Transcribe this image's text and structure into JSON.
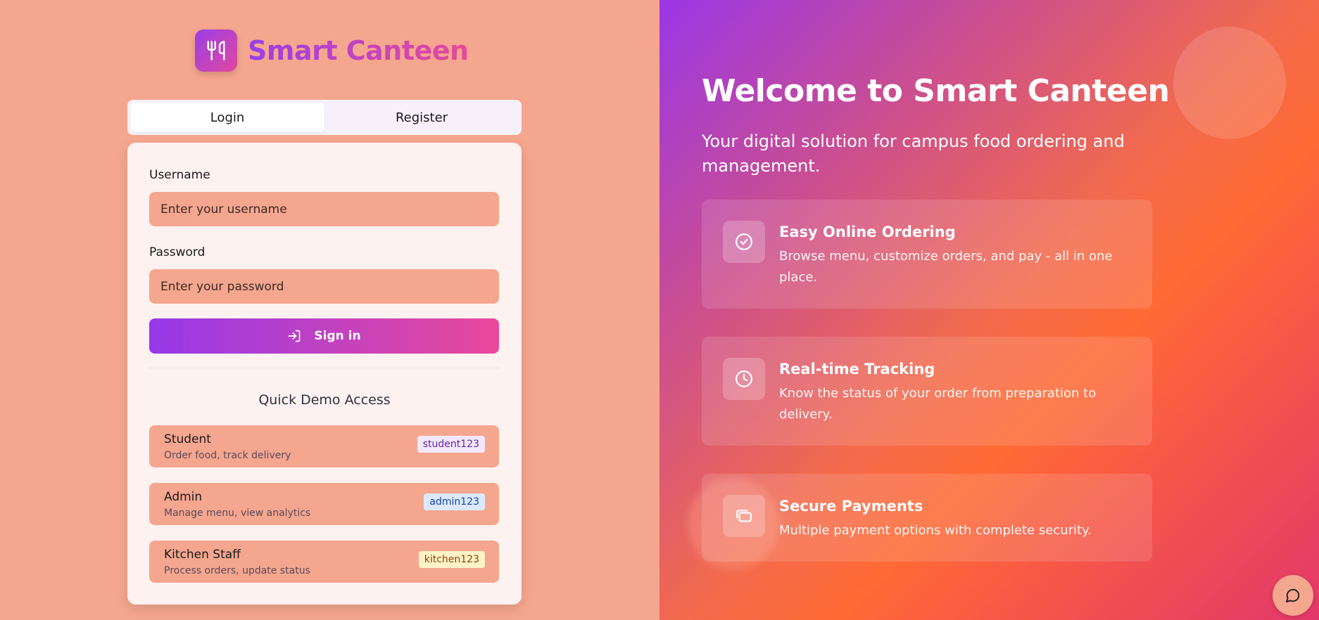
{
  "brand": {
    "name": "Smart Canteen"
  },
  "tabs": [
    {
      "label": "Login",
      "active": true
    },
    {
      "label": "Register",
      "active": false
    }
  ],
  "form": {
    "username_label": "Username",
    "username_placeholder": "Enter your username",
    "password_label": "Password",
    "password_placeholder": "Enter your password",
    "signin_label": "Sign in"
  },
  "quick_demo": {
    "title": "Quick Demo Access",
    "accounts": [
      {
        "role": "Student",
        "desc": "Order food, track delivery",
        "password": "student123",
        "badge_bg": "#f3e8ff",
        "badge_color": "#6b21a8"
      },
      {
        "role": "Admin",
        "desc": "Manage menu, view analytics",
        "password": "admin123",
        "badge_bg": "#dbeafe",
        "badge_color": "#1e40af"
      },
      {
        "role": "Kitchen Staff",
        "desc": "Process orders, update status",
        "password": "kitchen123",
        "badge_bg": "#fef3c7",
        "badge_color": "#92400e"
      }
    ]
  },
  "hero": {
    "title": "Welcome to Smart Canteen",
    "subtitle": "Your digital solution for campus food ordering and management.",
    "features": [
      {
        "icon": "check-circle-icon",
        "title": "Easy Online Ordering",
        "desc": "Browse menu, customize orders, and pay - all in one place."
      },
      {
        "icon": "clock-icon",
        "title": "Real-time Tracking",
        "desc": "Know the status of your order from preparation to delivery."
      },
      {
        "icon": "credit-card-icon",
        "title": "Secure Payments",
        "desc": "Multiple payment options with complete security."
      }
    ]
  },
  "colors": {
    "accent_purple": "#9539e9",
    "accent_pink": "#e9499a",
    "left_bg": "#f5a68e"
  }
}
